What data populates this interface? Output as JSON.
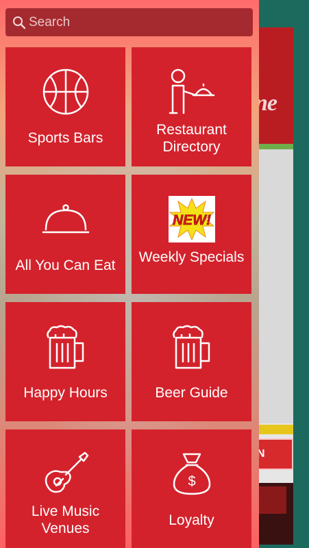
{
  "search": {
    "placeholder": "Search"
  },
  "tiles": [
    {
      "label": "Sports Bars",
      "icon": "basketball-icon"
    },
    {
      "label": "Restaurant Directory",
      "icon": "waiter-icon"
    },
    {
      "label": "All You Can Eat",
      "icon": "cloche-icon"
    },
    {
      "label": "Weekly Specials",
      "icon": "new-badge-icon",
      "badge_text": "NEW!"
    },
    {
      "label": "Happy Hours",
      "icon": "beer-mug-icon"
    },
    {
      "label": "Beer Guide",
      "icon": "beer-mug-icon"
    },
    {
      "label": "Live Music Venues",
      "icon": "guitar-icon"
    },
    {
      "label": "Loyalty",
      "icon": "money-bag-icon"
    }
  ],
  "background_app": {
    "partial_logo": "ne",
    "partial_button": "ATION"
  },
  "colors": {
    "tile": "#d3222c",
    "search_bg": "#a52a30",
    "side_bg": "#1c6a5e"
  }
}
